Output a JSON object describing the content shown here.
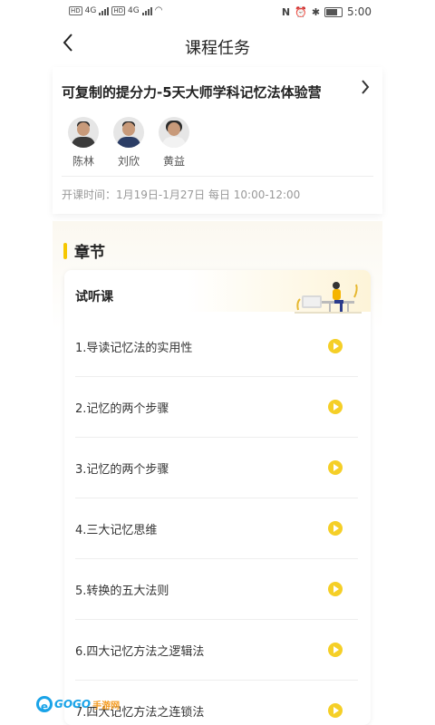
{
  "status_bar": {
    "hd1": "HD",
    "net1": "4G",
    "hd2": "HD",
    "net2": "4G",
    "nfc": "N",
    "time": "5:00"
  },
  "nav": {
    "back_icon": "back-chevron",
    "title": "课程任务"
  },
  "course": {
    "title": "可复制的提分力-5天大师学科记忆法体验营",
    "teachers": [
      {
        "name": "陈林"
      },
      {
        "name": "刘欣"
      },
      {
        "name": "黄益"
      }
    ],
    "time": "开课时间：1月19日-1月27日 每日 10:00-12:00"
  },
  "chapter": {
    "title": "章节",
    "section_title": "试听课",
    "lessons": [
      {
        "label": "1.导读记忆法的实用性"
      },
      {
        "label": "2.记忆的两个步骤"
      },
      {
        "label": "3.记忆的两个步骤"
      },
      {
        "label": "4.三大记忆思维"
      },
      {
        "label": "5.转换的五大法则"
      },
      {
        "label": "6.四大记忆方法之逻辑法"
      },
      {
        "label": "7.四大记忆方法之连锁法"
      }
    ]
  },
  "watermark": {
    "logo_letter": "e",
    "brand": "GOGO",
    "brand2": "手游网"
  },
  "colors": {
    "accent": "#f6c700",
    "play": "#f5cf27",
    "watermark_blue": "#19a3e8",
    "watermark_orange": "#f39a1f"
  }
}
